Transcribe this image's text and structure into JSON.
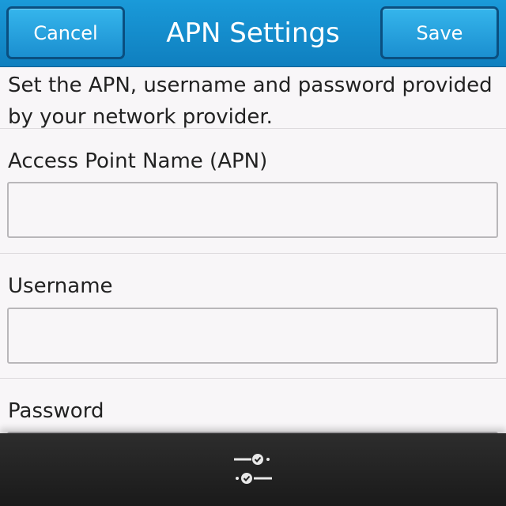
{
  "titlebar": {
    "title": "APN Settings",
    "cancel_label": "Cancel",
    "save_label": "Save",
    "accent_color": "#1a9ad9"
  },
  "description": "Set the APN, username and password provided by your network provider.",
  "fields": {
    "apn": {
      "label": "Access Point Name (APN)",
      "value": ""
    },
    "username": {
      "label": "Username",
      "value": ""
    },
    "password": {
      "label": "Password",
      "value": ""
    }
  },
  "action_bar": {
    "icon": "settings-sliders-icon"
  }
}
